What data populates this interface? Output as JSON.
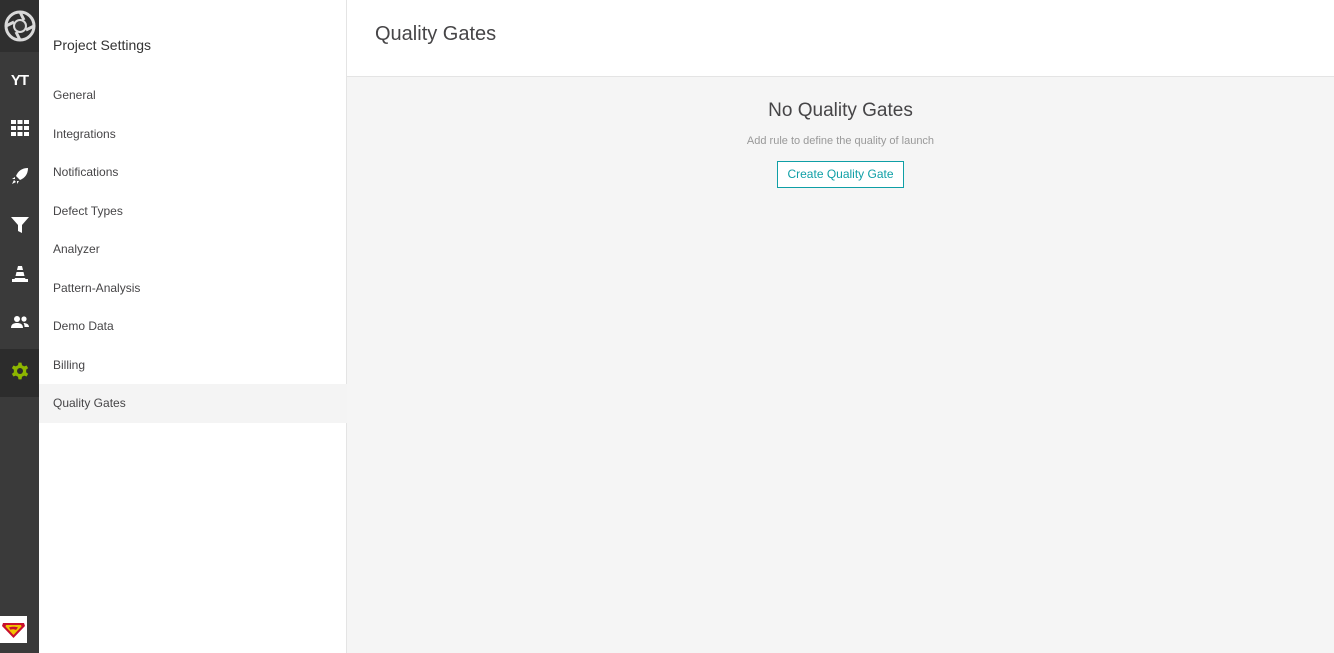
{
  "rail": {
    "items": [
      {
        "name": "yt-project",
        "label": "YT"
      },
      {
        "name": "dashboards-icon"
      },
      {
        "name": "launches-icon"
      },
      {
        "name": "filters-icon"
      },
      {
        "name": "debug-icon"
      },
      {
        "name": "members-icon"
      },
      {
        "name": "settings-icon",
        "active": true
      }
    ],
    "active_color": "#8db600"
  },
  "sidebar": {
    "title": "Project Settings",
    "items": [
      {
        "label": "General"
      },
      {
        "label": "Integrations"
      },
      {
        "label": "Notifications"
      },
      {
        "label": "Defect Types"
      },
      {
        "label": "Analyzer"
      },
      {
        "label": "Pattern-Analysis"
      },
      {
        "label": "Demo Data"
      },
      {
        "label": "Billing"
      },
      {
        "label": "Quality Gates",
        "active": true
      }
    ]
  },
  "main": {
    "title": "Quality Gates",
    "empty_title": "No Quality Gates",
    "empty_subtitle": "Add rule to define the quality of launch",
    "create_button": "Create Quality Gate"
  },
  "colors": {
    "accent": "#0f9fa6",
    "rail_bg": "#3a3a3a"
  }
}
